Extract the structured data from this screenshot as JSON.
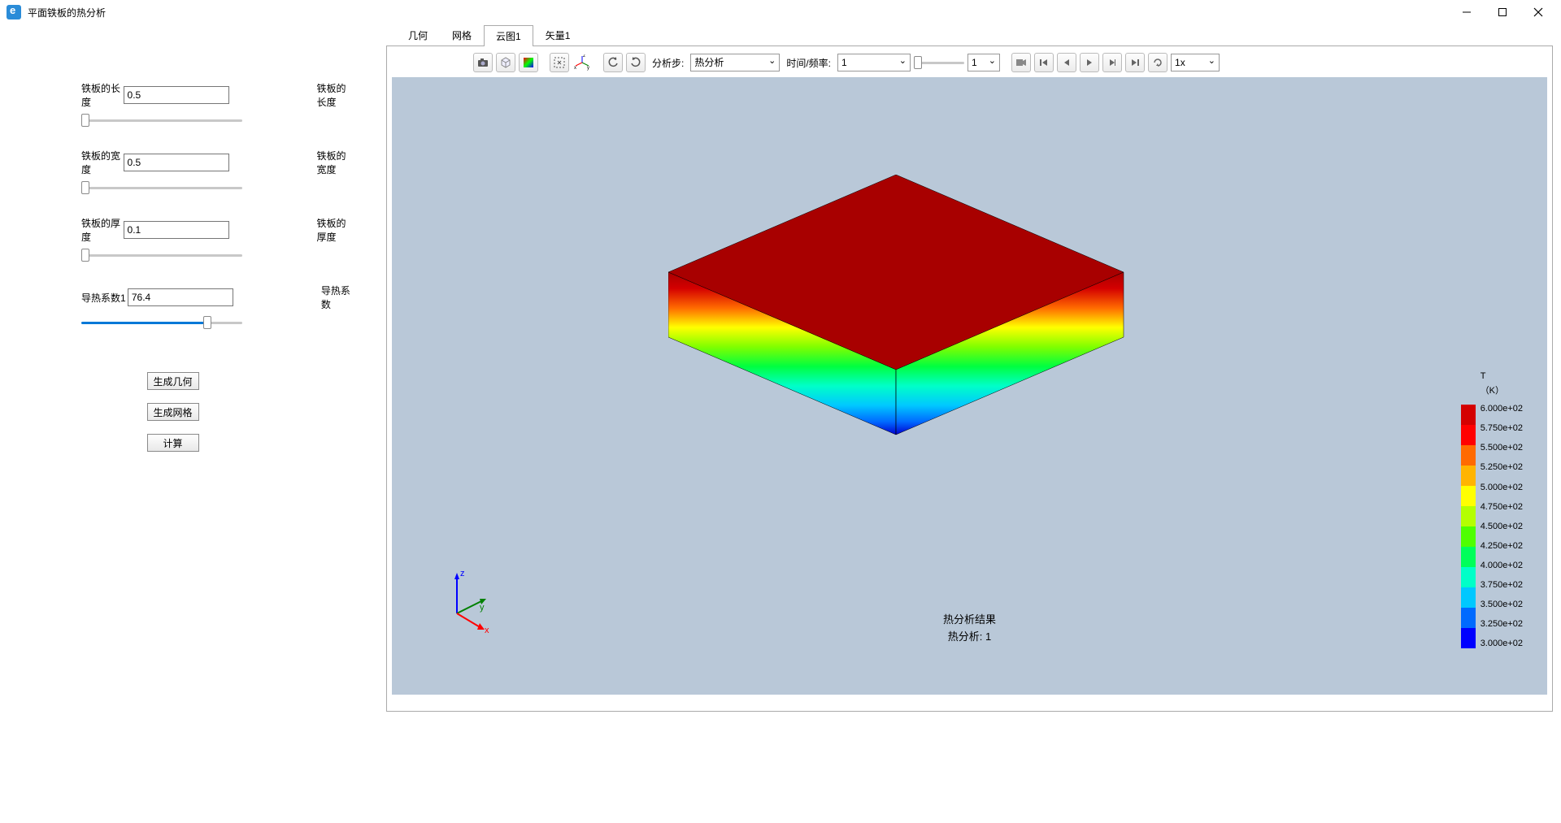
{
  "window": {
    "title": "平面铁板的热分析"
  },
  "sidebar": {
    "params": [
      {
        "label": "铁板的长度",
        "value": "0.5",
        "output": "铁板的长度"
      },
      {
        "label": "铁板的宽度",
        "value": "0.5",
        "output": "铁板的宽度"
      },
      {
        "label": "铁板的厚度",
        "value": "0.1",
        "output": "铁板的厚度"
      },
      {
        "label": "导热系数1",
        "value": "76.4",
        "output": "导热系数"
      }
    ],
    "buttons": {
      "geom": "生成几何",
      "mesh": "生成网格",
      "solve": "计算"
    }
  },
  "tabs": [
    "几何",
    "网格",
    "云图1",
    "矢量1"
  ],
  "toolbar": {
    "step_label": "分析步:",
    "step_value": "热分析",
    "time_label": "时间/频率:",
    "time_value": "1",
    "speed_value": "1",
    "rate_value": "1x"
  },
  "viewport": {
    "result_title_1": "热分析结果",
    "result_title_2": "热分析: 1",
    "legend_title_1": "T",
    "legend_title_2": "（K）",
    "legend_values": [
      "6.000e+02",
      "5.750e+02",
      "5.500e+02",
      "5.250e+02",
      "5.000e+02",
      "4.750e+02",
      "4.500e+02",
      "4.250e+02",
      "4.000e+02",
      "3.750e+02",
      "3.500e+02",
      "3.250e+02",
      "3.000e+02"
    ],
    "legend_colors": [
      "#d40000",
      "#ff0000",
      "#ff6a00",
      "#ffb400",
      "#ffff00",
      "#b4ff00",
      "#4fff00",
      "#00ff5a",
      "#00ffc8",
      "#00c8ff",
      "#006aff",
      "#0000ff"
    ]
  },
  "chart_data": {
    "type": "colormap",
    "variable": "T",
    "unit": "K",
    "range": [
      300,
      600
    ],
    "steps": 12,
    "values": [
      600,
      575,
      550,
      525,
      500,
      475,
      450,
      425,
      400,
      375,
      350,
      325,
      300
    ],
    "geometry": {
      "length": 0.5,
      "width": 0.5,
      "thickness": 0.1,
      "conductivity": 76.4
    },
    "description": "Temperature contour on a flat iron plate. Top face at 600K (red), bottom face at 300K (blue), linear gradient through thickness."
  }
}
